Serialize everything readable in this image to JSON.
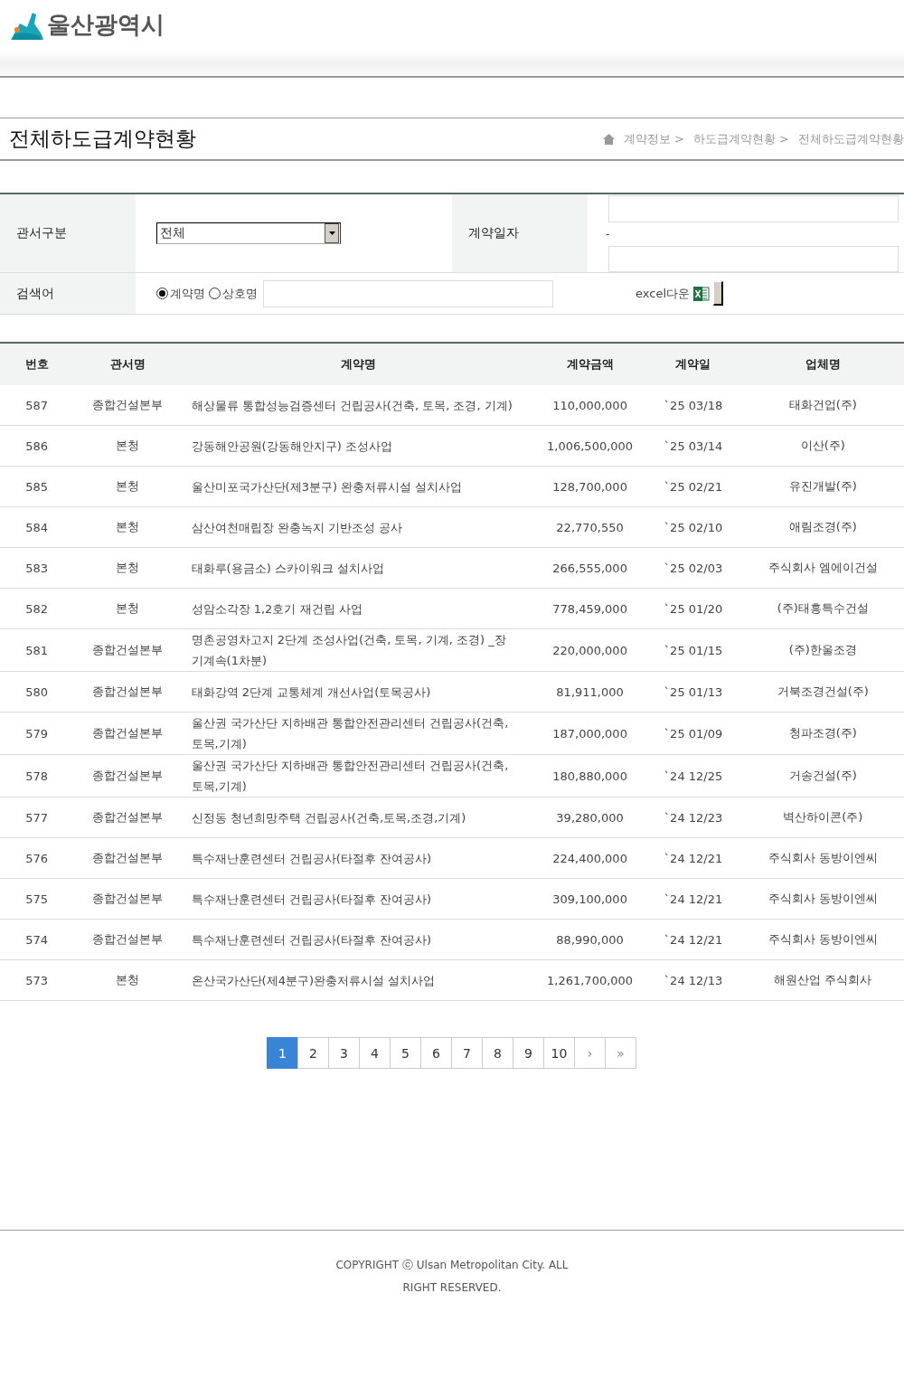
{
  "header": {
    "logo_text": "울산광역시"
  },
  "page_title": "전체하도급계약현황",
  "breadcrumb": [
    "계약정보 >",
    "하도급계약현황 >",
    "전체하도급계약현황"
  ],
  "filters": {
    "office_label": "관서구분",
    "office_value": "전체",
    "date_label": "계약일자",
    "date_separator": "-",
    "search_label": "검색어",
    "search_options": [
      {
        "label": "계약명",
        "selected": true
      },
      {
        "label": "상호명",
        "selected": false
      }
    ],
    "excel_label": "excel다운"
  },
  "table": {
    "columns": [
      "번호",
      "관서명",
      "계약명",
      "계약금액",
      "계약일",
      "업체명"
    ],
    "rows": [
      [
        "587",
        "종합건설본부",
        "해상물류 통합성능검증센터 건립공사(건축, 토목, 조경, 기계)",
        "110,000,000",
        "`25 03/18",
        "태화건업(주)"
      ],
      [
        "586",
        "본청",
        "강동해안공원(강동해안지구) 조성사업",
        "1,006,500,000",
        "`25 03/14",
        "이산(주)"
      ],
      [
        "585",
        "본청",
        "울산미포국가산단(제3분구) 완충저류시설 설치사업",
        "128,700,000",
        "`25 02/21",
        "유진개발(주)"
      ],
      [
        "584",
        "본청",
        "삼산여천매립장 완충녹지 기반조성 공사",
        "22,770,550",
        "`25 02/10",
        "애림조경(주)"
      ],
      [
        "583",
        "본청",
        "태화루(용금소) 스카이워크 설치사업",
        "266,555,000",
        "`25 02/03",
        "주식회사 엠에이건설"
      ],
      [
        "582",
        "본청",
        "성암소각장 1,2호기 재건립 사업",
        "778,459,000",
        "`25 01/20",
        "(주)태흥특수건설"
      ],
      [
        "581",
        "종합건설본부",
        "명촌공영차고지 2단계 조성사업(건축, 토목, 기계, 조경) _장기계속(1차분)",
        "220,000,000",
        "`25 01/15",
        "(주)한울조경"
      ],
      [
        "580",
        "종합건설본부",
        "태화강역 2단계 교통체계 개선사업(토목공사)",
        "81,911,000",
        "`25 01/13",
        "거북조경건설(주)"
      ],
      [
        "579",
        "종합건설본부",
        "울산권 국가산단 지하배관 통합안전관리센터 건립공사(건축,토목,기계)",
        "187,000,000",
        "`25 01/09",
        "청파조경(주)"
      ],
      [
        "578",
        "종합건설본부",
        "울산권 국가산단 지하배관 통합안전관리센터 건립공사(건축,토목,기계)",
        "180,880,000",
        "`24 12/25",
        "거송건설(주)"
      ],
      [
        "577",
        "종합건설본부",
        "신정동 청년희망주택 건립공사(건축,토목,조경,기계)",
        "39,280,000",
        "`24 12/23",
        "벽산하이콘(주)"
      ],
      [
        "576",
        "종합건설본부",
        "특수재난훈련센터 건립공사(타절후 잔여공사)",
        "224,400,000",
        "`24 12/21",
        "주식회사 동방이엔씨"
      ],
      [
        "575",
        "종합건설본부",
        "특수재난훈련센터 건립공사(타절후 잔여공사)",
        "309,100,000",
        "`24 12/21",
        "주식회사 동방이엔씨"
      ],
      [
        "574",
        "종합건설본부",
        "특수재난훈련센터 건립공사(타절후 잔여공사)",
        "88,990,000",
        "`24 12/21",
        "주식회사 동방이엔씨"
      ],
      [
        "573",
        "본청",
        "온산국가산단(제4분구)완충저류시설 설치사업",
        "1,261,700,000",
        "`24 12/13",
        "해원산업 주식회사"
      ]
    ]
  },
  "pagination": {
    "pages": [
      {
        "label": "1",
        "selected": true
      },
      {
        "label": "2",
        "selected": false
      },
      {
        "label": "3",
        "selected": false
      },
      {
        "label": "4",
        "selected": false
      },
      {
        "label": "5",
        "selected": false
      },
      {
        "label": "6",
        "selected": false
      },
      {
        "label": "7",
        "selected": false
      },
      {
        "label": "8",
        "selected": false
      },
      {
        "label": "9",
        "selected": false
      },
      {
        "label": "10",
        "selected": false
      }
    ],
    "next": "›",
    "last": "»"
  },
  "footer": {
    "copyright": "COPYRIGHT ⓒ Ulsan Metropolitan City. ALL RIGHT RESERVED."
  }
}
